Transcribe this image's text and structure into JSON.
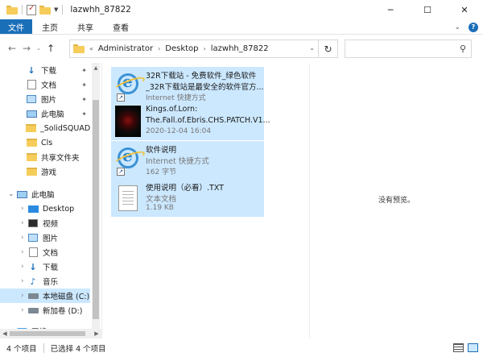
{
  "window": {
    "title": "lazwhh_87822",
    "minimize_icon": "─",
    "maximize_icon": "☐",
    "close_icon": "✕"
  },
  "ribbon": {
    "tabs": [
      "文件",
      "主页",
      "共享",
      "查看"
    ],
    "expand_icon": "⌄"
  },
  "address": {
    "back": "←",
    "forward": "→",
    "recent": "⌄",
    "up": "↑",
    "chevron": "«",
    "separator": "›",
    "crumbs": [
      "Administrator",
      "Desktop",
      "lazwhh_87822"
    ],
    "dropdown": "⌄",
    "refresh": "↻",
    "search_placeholder": "",
    "search_icon": "⚲"
  },
  "nav": {
    "quick_access": [
      {
        "label": "下载",
        "icon": "download-icon",
        "pinned": true
      },
      {
        "label": "文档",
        "icon": "document-icon",
        "pinned": true
      },
      {
        "label": "图片",
        "icon": "pictures-icon",
        "pinned": true
      },
      {
        "label": "此电脑",
        "icon": "computer-icon",
        "pinned": true
      },
      {
        "label": "_SolidSQUAD_",
        "icon": "folder-icon",
        "pinned": false
      },
      {
        "label": "Cls",
        "icon": "folder-icon",
        "pinned": false
      },
      {
        "label": "共享文件夹",
        "icon": "folder-icon",
        "pinned": false
      },
      {
        "label": "游戏",
        "icon": "folder-icon",
        "pinned": false
      }
    ],
    "this_pc": "此电脑",
    "this_pc_items": [
      {
        "label": "Desktop",
        "icon": "desktop-icon"
      },
      {
        "label": "视频",
        "icon": "video-icon"
      },
      {
        "label": "图片",
        "icon": "pictures-icon"
      },
      {
        "label": "文档",
        "icon": "document-icon"
      },
      {
        "label": "下载",
        "icon": "download-icon"
      },
      {
        "label": "音乐",
        "icon": "music-icon"
      },
      {
        "label": "本地磁盘 (C:)",
        "icon": "drive-icon"
      },
      {
        "label": "新加卷 (D:)",
        "icon": "drive-icon"
      }
    ],
    "network": "网络",
    "pin_glyph": "📌",
    "expand_glyph": "›",
    "download_glyph": "↓",
    "music_glyph": "♪"
  },
  "files": [
    {
      "name1": "32R下载站 - 免费软件_绿色软件",
      "name2": "_32R下载站是最安全的软件官方...",
      "meta": "Internet 快捷方式",
      "icon": "internet-shortcut-icon"
    },
    {
      "name1": "Kings.of.Lorn:",
      "name2": "The.Fall.of.Ebris.CHS.PATCH.V1...",
      "meta": "2020-12-04 16:04",
      "icon": "game-thumbnail"
    },
    {
      "name1": "软件说明",
      "name2": "Internet 快捷方式",
      "meta": "162 字节",
      "icon": "internet-shortcut-icon"
    },
    {
      "name1": "使用说明（必看）.TXT",
      "name2": "文本文档",
      "meta": "1.19 KB",
      "icon": "text-file-icon"
    }
  ],
  "shortcut_arrow": "↗",
  "preview": {
    "message": "没有预览。"
  },
  "status": {
    "item_count": "4 个项目",
    "selected": "已选择 4 个项目"
  },
  "scroll": {
    "up": "▲",
    "down": "▼",
    "left": "◀",
    "right": "▶"
  }
}
